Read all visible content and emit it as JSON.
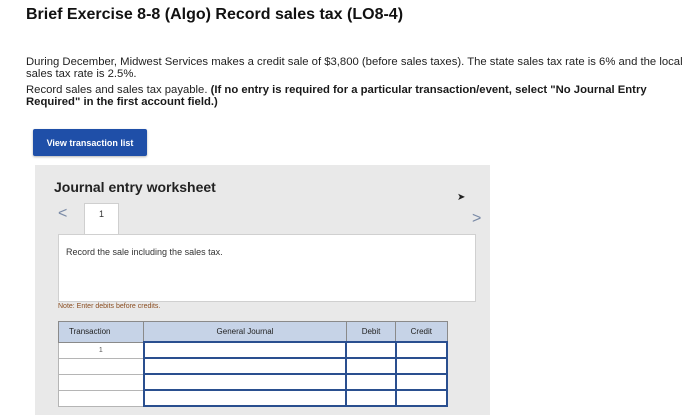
{
  "header": {
    "title": "Brief Exercise 8-8 (Algo) Record sales tax (LO8-4)"
  },
  "problem": {
    "paragraph1": "During December, Midwest Services makes a credit sale of $3,800 (before sales taxes). The state sales tax rate is 6% and the local sales tax rate is 2.5%.",
    "paragraph2_plain": "Record sales and sales tax payable.",
    "paragraph2_bold": "(If no entry is required for a particular transaction/event, select \"No Journal Entry Required\" in the first account field.)"
  },
  "buttons": {
    "view_transaction_list": "View transaction list"
  },
  "worksheet": {
    "title": "Journal entry worksheet",
    "nav_prev": "<",
    "nav_next": ">",
    "active_tab": "1",
    "description": "Record the sale including the sales tax.",
    "note": "Note: Enter debits before credits."
  },
  "journal_table": {
    "headers": [
      "Transaction",
      "General Journal",
      "Debit",
      "Credit"
    ],
    "rows": [
      [
        "1",
        "",
        "",
        ""
      ],
      [
        "",
        "",
        "",
        ""
      ],
      [
        "",
        "",
        "",
        ""
      ],
      [
        "",
        "",
        "",
        ""
      ]
    ]
  },
  "colors": {
    "button_bg": "#1f4fa8",
    "table_header_bg": "#c6d3e7",
    "input_border": "#2a4f8f",
    "note_text": "#8a4d20"
  }
}
